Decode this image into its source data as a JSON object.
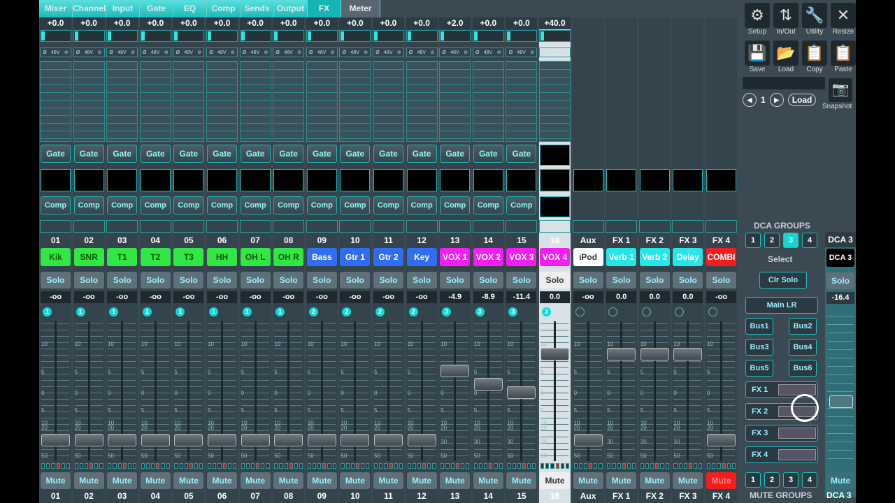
{
  "tabs": [
    "Mixer",
    "Channel",
    "Input",
    "Gate",
    "EQ",
    "Comp",
    "Sends",
    "Output",
    "FX",
    "Meter"
  ],
  "selected_tab": "FX",
  "strips": [
    {
      "num": "01",
      "name": "Kik",
      "color": "#32e646",
      "text": "#0b5a0b",
      "gain": "+0.0",
      "level": "-oo",
      "dca": "1"
    },
    {
      "num": "02",
      "name": "SNR",
      "color": "#32e646",
      "text": "#0b5a0b",
      "gain": "+0.0",
      "level": "-oo",
      "dca": "1"
    },
    {
      "num": "03",
      "name": "T1",
      "color": "#32e646",
      "text": "#0b5a0b",
      "gain": "+0.0",
      "level": "-oo",
      "dca": "1"
    },
    {
      "num": "04",
      "name": "T2",
      "color": "#32e646",
      "text": "#0b5a0b",
      "gain": "+0.0",
      "level": "-oo",
      "dca": "1"
    },
    {
      "num": "05",
      "name": "T3",
      "color": "#32e646",
      "text": "#0b5a0b",
      "gain": "+0.0",
      "level": "-oo",
      "dca": "1"
    },
    {
      "num": "06",
      "name": "HH",
      "color": "#32e646",
      "text": "#0b5a0b",
      "gain": "+0.0",
      "level": "-oo",
      "dca": "1"
    },
    {
      "num": "07",
      "name": "OH L",
      "color": "#32e646",
      "text": "#0b5a0b",
      "gain": "+0.0",
      "level": "-oo",
      "dca": "1"
    },
    {
      "num": "08",
      "name": "OH R",
      "color": "#32e646",
      "text": "#0b5a0b",
      "gain": "+0.0",
      "level": "-oo",
      "dca": "1"
    },
    {
      "num": "09",
      "name": "Bass",
      "color": "#2f6ef2",
      "text": "#fff",
      "gain": "+0.0",
      "level": "-oo",
      "dca": "2"
    },
    {
      "num": "10",
      "name": "Gtr 1",
      "color": "#2f6ef2",
      "text": "#fff",
      "gain": "+0.0",
      "level": "-oo",
      "dca": "2"
    },
    {
      "num": "11",
      "name": "Gtr 2",
      "color": "#2f6ef2",
      "text": "#fff",
      "gain": "+0.0",
      "level": "-oo",
      "dca": "2"
    },
    {
      "num": "12",
      "name": "Key",
      "color": "#2f6ef2",
      "text": "#fff",
      "gain": "+0.0",
      "level": "-oo",
      "dca": "2"
    },
    {
      "num": "13",
      "name": "VOX 1",
      "color": "#f21ef2",
      "text": "#fff",
      "gain": "+2.0",
      "level": "-4.9",
      "dca": "3"
    },
    {
      "num": "14",
      "name": "VOX 2",
      "color": "#f21ef2",
      "text": "#fff",
      "gain": "+0.0",
      "level": "-8.9",
      "dca": "3"
    },
    {
      "num": "15",
      "name": "VOX 3",
      "color": "#f21ef2",
      "text": "#fff",
      "gain": "+0.0",
      "level": "-11.4",
      "dca": "3"
    },
    {
      "num": "16",
      "name": "VOX 4",
      "color": "#f21ef2",
      "text": "#fff",
      "gain": "+40.0",
      "level": "0.0",
      "dca": "3"
    },
    {
      "num": "Aux",
      "name": "iPod",
      "color": "#ffffff",
      "text": "#333",
      "gain": "",
      "level": "-oo",
      "dca": ""
    },
    {
      "num": "FX 1",
      "name": "Verb 1",
      "color": "#26e6e6",
      "text": "#fff",
      "gain": "",
      "level": "0.0",
      "dca": ""
    },
    {
      "num": "FX 2",
      "name": "Verb 2",
      "color": "#26e6e6",
      "text": "#fff",
      "gain": "",
      "level": "0.0",
      "dca": ""
    },
    {
      "num": "FX 3",
      "name": "Delay",
      "color": "#26e6e6",
      "text": "#fff",
      "gain": "",
      "level": "0.0",
      "dca": ""
    },
    {
      "num": "FX 4",
      "name": "COMBI",
      "color": "#f21e1e",
      "text": "#fff",
      "gain": "",
      "level": "-oo",
      "dca": ""
    }
  ],
  "labels": {
    "gate": "Gate",
    "comp": "Comp",
    "solo": "Solo",
    "mute": "Mute"
  },
  "tools": [
    {
      "label": "Setup",
      "icon": "⚙"
    },
    {
      "label": "In/Out",
      "icon": "⇅"
    },
    {
      "label": "Utility",
      "icon": "🔧"
    },
    {
      "label": "Resize",
      "icon": "✕"
    },
    {
      "label": "Save",
      "icon": "💾"
    },
    {
      "label": "Load",
      "icon": "📂"
    },
    {
      "label": "Copy",
      "icon": "📋"
    },
    {
      "label": "Paste",
      "icon": "📋"
    }
  ],
  "snapshot": {
    "number": "1",
    "load": "Load",
    "label": "Snapshot"
  },
  "dca": {
    "header": "DCA GROUPS",
    "groups": [
      "1",
      "2",
      "3",
      "4"
    ],
    "active": "3",
    "select": "Select",
    "clr_solo": "Clr Solo",
    "main": "Main LR",
    "buses": [
      "Bus1",
      "Bus2",
      "Bus3",
      "Bus4",
      "Bus5",
      "Bus6"
    ],
    "fx": [
      "FX 1",
      "FX 2",
      "FX 3",
      "FX 4"
    ],
    "name": "DCA 3",
    "solo": "Solo",
    "level": "-16.4",
    "mute": "Mute"
  },
  "mute_groups": {
    "header": "MUTE GROUPS",
    "groups": [
      "1",
      "2",
      "3",
      "4"
    ]
  },
  "fader_positions": [
    0.1,
    0.1,
    0.1,
    0.1,
    0.1,
    0.1,
    0.1,
    0.1,
    0.1,
    0.1,
    0.1,
    0.1,
    0.62,
    0.52,
    0.46,
    0.75,
    0.1,
    0.75,
    0.75,
    0.75,
    0.1
  ]
}
